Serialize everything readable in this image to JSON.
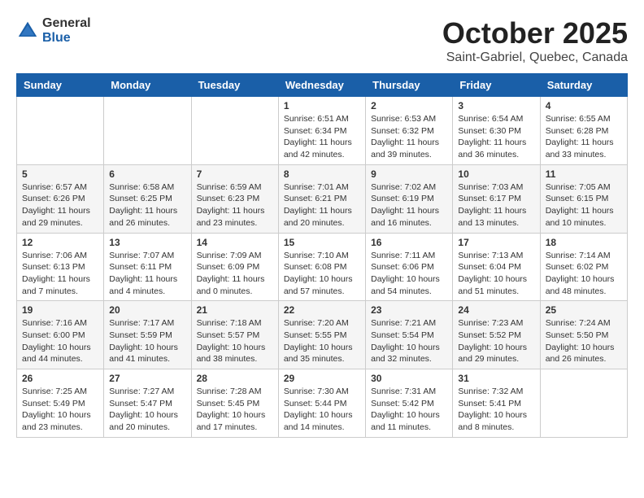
{
  "header": {
    "logo_general": "General",
    "logo_blue": "Blue",
    "month_title": "October 2025",
    "location": "Saint-Gabriel, Quebec, Canada"
  },
  "calendar": {
    "days_of_week": [
      "Sunday",
      "Monday",
      "Tuesday",
      "Wednesday",
      "Thursday",
      "Friday",
      "Saturday"
    ],
    "weeks": [
      [
        {
          "day": "",
          "info": ""
        },
        {
          "day": "",
          "info": ""
        },
        {
          "day": "",
          "info": ""
        },
        {
          "day": "1",
          "info": "Sunrise: 6:51 AM\nSunset: 6:34 PM\nDaylight: 11 hours\nand 42 minutes."
        },
        {
          "day": "2",
          "info": "Sunrise: 6:53 AM\nSunset: 6:32 PM\nDaylight: 11 hours\nand 39 minutes."
        },
        {
          "day": "3",
          "info": "Sunrise: 6:54 AM\nSunset: 6:30 PM\nDaylight: 11 hours\nand 36 minutes."
        },
        {
          "day": "4",
          "info": "Sunrise: 6:55 AM\nSunset: 6:28 PM\nDaylight: 11 hours\nand 33 minutes."
        }
      ],
      [
        {
          "day": "5",
          "info": "Sunrise: 6:57 AM\nSunset: 6:26 PM\nDaylight: 11 hours\nand 29 minutes."
        },
        {
          "day": "6",
          "info": "Sunrise: 6:58 AM\nSunset: 6:25 PM\nDaylight: 11 hours\nand 26 minutes."
        },
        {
          "day": "7",
          "info": "Sunrise: 6:59 AM\nSunset: 6:23 PM\nDaylight: 11 hours\nand 23 minutes."
        },
        {
          "day": "8",
          "info": "Sunrise: 7:01 AM\nSunset: 6:21 PM\nDaylight: 11 hours\nand 20 minutes."
        },
        {
          "day": "9",
          "info": "Sunrise: 7:02 AM\nSunset: 6:19 PM\nDaylight: 11 hours\nand 16 minutes."
        },
        {
          "day": "10",
          "info": "Sunrise: 7:03 AM\nSunset: 6:17 PM\nDaylight: 11 hours\nand 13 minutes."
        },
        {
          "day": "11",
          "info": "Sunrise: 7:05 AM\nSunset: 6:15 PM\nDaylight: 11 hours\nand 10 minutes."
        }
      ],
      [
        {
          "day": "12",
          "info": "Sunrise: 7:06 AM\nSunset: 6:13 PM\nDaylight: 11 hours\nand 7 minutes."
        },
        {
          "day": "13",
          "info": "Sunrise: 7:07 AM\nSunset: 6:11 PM\nDaylight: 11 hours\nand 4 minutes."
        },
        {
          "day": "14",
          "info": "Sunrise: 7:09 AM\nSunset: 6:09 PM\nDaylight: 11 hours\nand 0 minutes."
        },
        {
          "day": "15",
          "info": "Sunrise: 7:10 AM\nSunset: 6:08 PM\nDaylight: 10 hours\nand 57 minutes."
        },
        {
          "day": "16",
          "info": "Sunrise: 7:11 AM\nSunset: 6:06 PM\nDaylight: 10 hours\nand 54 minutes."
        },
        {
          "day": "17",
          "info": "Sunrise: 7:13 AM\nSunset: 6:04 PM\nDaylight: 10 hours\nand 51 minutes."
        },
        {
          "day": "18",
          "info": "Sunrise: 7:14 AM\nSunset: 6:02 PM\nDaylight: 10 hours\nand 48 minutes."
        }
      ],
      [
        {
          "day": "19",
          "info": "Sunrise: 7:16 AM\nSunset: 6:00 PM\nDaylight: 10 hours\nand 44 minutes."
        },
        {
          "day": "20",
          "info": "Sunrise: 7:17 AM\nSunset: 5:59 PM\nDaylight: 10 hours\nand 41 minutes."
        },
        {
          "day": "21",
          "info": "Sunrise: 7:18 AM\nSunset: 5:57 PM\nDaylight: 10 hours\nand 38 minutes."
        },
        {
          "day": "22",
          "info": "Sunrise: 7:20 AM\nSunset: 5:55 PM\nDaylight: 10 hours\nand 35 minutes."
        },
        {
          "day": "23",
          "info": "Sunrise: 7:21 AM\nSunset: 5:54 PM\nDaylight: 10 hours\nand 32 minutes."
        },
        {
          "day": "24",
          "info": "Sunrise: 7:23 AM\nSunset: 5:52 PM\nDaylight: 10 hours\nand 29 minutes."
        },
        {
          "day": "25",
          "info": "Sunrise: 7:24 AM\nSunset: 5:50 PM\nDaylight: 10 hours\nand 26 minutes."
        }
      ],
      [
        {
          "day": "26",
          "info": "Sunrise: 7:25 AM\nSunset: 5:49 PM\nDaylight: 10 hours\nand 23 minutes."
        },
        {
          "day": "27",
          "info": "Sunrise: 7:27 AM\nSunset: 5:47 PM\nDaylight: 10 hours\nand 20 minutes."
        },
        {
          "day": "28",
          "info": "Sunrise: 7:28 AM\nSunset: 5:45 PM\nDaylight: 10 hours\nand 17 minutes."
        },
        {
          "day": "29",
          "info": "Sunrise: 7:30 AM\nSunset: 5:44 PM\nDaylight: 10 hours\nand 14 minutes."
        },
        {
          "day": "30",
          "info": "Sunrise: 7:31 AM\nSunset: 5:42 PM\nDaylight: 10 hours\nand 11 minutes."
        },
        {
          "day": "31",
          "info": "Sunrise: 7:32 AM\nSunset: 5:41 PM\nDaylight: 10 hours\nand 8 minutes."
        },
        {
          "day": "",
          "info": ""
        }
      ]
    ]
  }
}
